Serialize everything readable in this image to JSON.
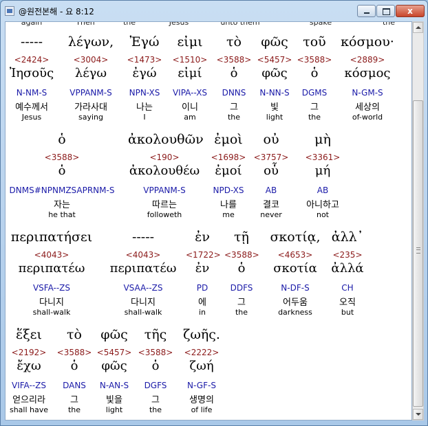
{
  "window": {
    "title": "@원전본해 - 요 8:12",
    "controls": {
      "minimize": "",
      "maximize": "",
      "close": "x"
    }
  },
  "top_partial": [
    "again",
    "Then",
    "the",
    "Jesus",
    "unto them",
    "spake",
    "the"
  ],
  "rows": [
    {
      "words": [
        {
          "greek": "-----",
          "strong": "<2424>",
          "lemma": "Ἰησοῦς",
          "parse": "N-NM-S",
          "korean": "예수께서",
          "english": "Jesus"
        },
        {
          "greek": "λέγων,",
          "strong": "<3004>",
          "lemma": "λέγω",
          "parse": "VPPANM-S",
          "korean": "가라사대",
          "english": "saying"
        },
        {
          "greek": "Ἐγώ",
          "strong": "<1473>",
          "lemma": "ἐγώ",
          "parse": "NPN-XS",
          "korean": "나는",
          "english": "I"
        },
        {
          "greek": "εἰμι",
          "strong": "<1510>",
          "lemma": "εἰμί",
          "parse": "VIPA--XS",
          "korean": "이니",
          "english": "am"
        },
        {
          "greek": "τὸ",
          "strong": "<3588>",
          "lemma": "ὁ",
          "parse": "DNNS",
          "korean": "그",
          "english": "the"
        },
        {
          "greek": "φῶς",
          "strong": "<5457>",
          "lemma": "φῶς",
          "parse": "N-NN-S",
          "korean": "빛",
          "english": "light"
        },
        {
          "greek": "τοῦ",
          "strong": "<3588>",
          "lemma": "ὁ",
          "parse": "DGMS",
          "korean": "그",
          "english": "the"
        },
        {
          "greek": "κόσμου·",
          "strong": "<2889>",
          "lemma": "κόσμος",
          "parse": "N-GM-S",
          "korean": "세상의",
          "english": "of-world"
        }
      ]
    },
    {
      "words": [
        {
          "greek": "ὁ",
          "strong": "<3588>",
          "lemma": "ὁ",
          "parse": "DNMS#NPNMZSAPRNM-S",
          "korean": "자는",
          "english": "he that"
        },
        {
          "greek": "ἀκολουθῶν",
          "strong": "<190>",
          "lemma": "ἀκολουθέω",
          "parse": "VPPANM-S",
          "korean": "따르는",
          "english": "followeth"
        },
        {
          "greek": "ἐμοὶ",
          "strong": "<1698>",
          "lemma": "ἐμοί",
          "parse": "NPD-XS",
          "korean": "나를",
          "english": "me"
        },
        {
          "greek": "οὐ",
          "strong": "<3757>",
          "lemma": "οὗ",
          "parse": "AB",
          "korean": "결코",
          "english": "never"
        },
        {
          "greek": "μὴ",
          "strong": "<3361>",
          "lemma": "μή",
          "parse": "AB",
          "korean": "아니하고",
          "english": "not"
        }
      ]
    },
    {
      "words": [
        {
          "greek": "περιπατήσει",
          "strong": "<4043>",
          "lemma": "περιπατέω",
          "parse": "VSFA--ZS",
          "korean": "다니지",
          "english": "shall-walk"
        },
        {
          "greek": "-----",
          "strong": "<4043>",
          "lemma": "περιπατέω",
          "parse": "VSAA--ZS",
          "korean": "다니지",
          "english": "shall-walk"
        },
        {
          "greek": "ἐν",
          "strong": "<1722>",
          "lemma": "ἐν",
          "parse": "PD",
          "korean": "에",
          "english": "in"
        },
        {
          "greek": "τῇ",
          "strong": "<3588>",
          "lemma": "ὁ",
          "parse": "DDFS",
          "korean": "그",
          "english": "the"
        },
        {
          "greek": "σκοτίᾳ,",
          "strong": "<4653>",
          "lemma": "σκοτία",
          "parse": "N-DF-S",
          "korean": "어두움",
          "english": "darkness"
        },
        {
          "greek": "ἀλλ᾽",
          "strong": "<235>",
          "lemma": "ἀλλά",
          "parse": "CH",
          "korean": "오직",
          "english": "but"
        }
      ]
    },
    {
      "words": [
        {
          "greek": "ἕξει",
          "strong": "<2192>",
          "lemma": "ἔχω",
          "parse": "VIFA--ZS",
          "korean": "얻으리라",
          "english": "shall have"
        },
        {
          "greek": "τὸ",
          "strong": "<3588>",
          "lemma": "ὁ",
          "parse": "DANS",
          "korean": "그",
          "english": "the"
        },
        {
          "greek": "φῶς",
          "strong": "<5457>",
          "lemma": "φῶς",
          "parse": "N-AN-S",
          "korean": "빛을",
          "english": "light"
        },
        {
          "greek": "τῆς",
          "strong": "<3588>",
          "lemma": "ὁ",
          "parse": "DGFS",
          "korean": "그",
          "english": "the"
        },
        {
          "greek": "ζωῆς.",
          "strong": "<2222>",
          "lemma": "ζωή",
          "parse": "N-GF-S",
          "korean": "생명의",
          "english": "of life"
        }
      ]
    }
  ]
}
